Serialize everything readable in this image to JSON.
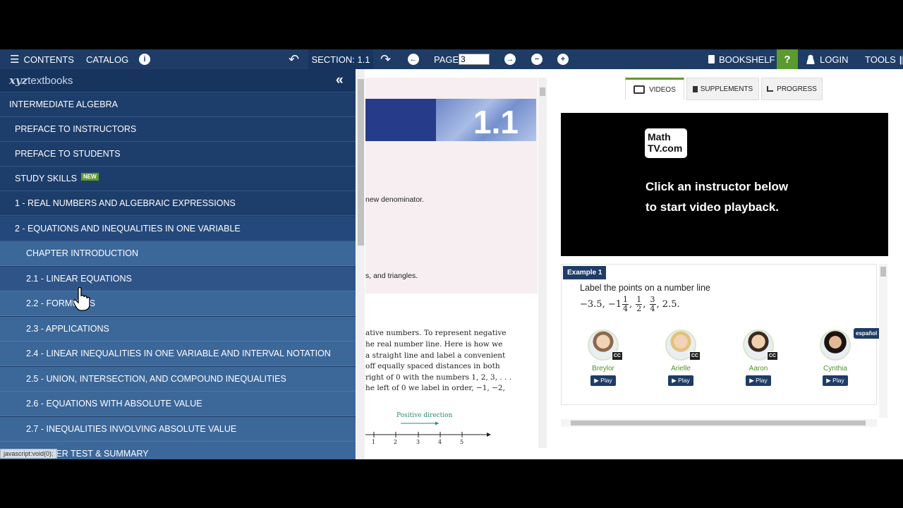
{
  "toolbar": {
    "contents": "CONTENTS",
    "catalog": "CATALOG",
    "section": "SECTION: 1.1",
    "page_label": "PAGE",
    "page_value": "3",
    "bookshelf": "BOOKSHELF",
    "help": "?",
    "login": "LOGIN",
    "tools": "TOOLS",
    "info_glyph": "i",
    "undo_glyph": "↶",
    "redo_glyph": "↷",
    "prev_glyph": "←",
    "next_glyph": "→",
    "zoom_out_glyph": "−",
    "zoom_in_glyph": "+"
  },
  "sidebar": {
    "logo_xyz": "xyz",
    "logo_rest": "textbooks",
    "collapse": "«",
    "items": [
      {
        "label": "INTERMEDIATE ALGEBRA"
      },
      {
        "label": "PREFACE TO INSTRUCTORS"
      },
      {
        "label": "PREFACE TO STUDENTS"
      },
      {
        "label": "STUDY SKILLS",
        "badge": "NEW"
      },
      {
        "label": "1 - REAL NUMBERS AND ALGEBRAIC EXPRESSIONS"
      },
      {
        "label": "2 - EQUATIONS AND INEQUALITIES IN ONE VARIABLE"
      },
      {
        "label": "CHAPTER INTRODUCTION"
      },
      {
        "label": "2.1 - LINEAR EQUATIONS"
      },
      {
        "label": "2.2 - FORMULAS"
      },
      {
        "label": "2.3 - APPLICATIONS"
      },
      {
        "label": "2.4 - LINEAR INEQUALITIES IN ONE VARIABLE AND INTERVAL NOTATION"
      },
      {
        "label": "2.5 - UNION, INTERSECTION, AND COMPOUND INEQUALITIES"
      },
      {
        "label": "2.6 - EQUATIONS WITH ABSOLUTE VALUE"
      },
      {
        "label": "2.7 - INEQUALITIES INVOLVING ABSOLUTE VALUE"
      },
      {
        "label": "CHAPTER TEST & SUMMARY"
      }
    ],
    "status": "javascript:void(0);"
  },
  "book": {
    "section_number": "1.1",
    "line1": "new denominator.",
    "line2": "s, and triangles.",
    "body": [
      "ative numbers. To represent negative",
      "he real number line. Here is how we",
      "a straight line and label a convenient",
      "off equally spaced distances in both",
      "right of 0 with the numbers 1, 2, 3, . . .",
      "he left of 0 we label in order, −1, −2,"
    ],
    "positive_direction": "Positive direction",
    "ticks": [
      "1",
      "2",
      "3",
      "4",
      "5"
    ]
  },
  "panel": {
    "tabs": [
      "VIDEOS",
      "SUPPLEMENTS",
      "PROGRESS"
    ],
    "video": {
      "logo_top": "Math",
      "logo_bottom": "TV.com",
      "message": "Click an instructor below\nto start video playback."
    },
    "example": {
      "label": "Example 1",
      "text": "Label the points on a number line",
      "math_prefix": "−3.5, −1",
      "math_suffix": ", 2.5.",
      "fractions": [
        [
          "1",
          "4"
        ],
        [
          "1",
          "2"
        ],
        [
          "3",
          "4"
        ]
      ],
      "instructors": [
        {
          "name": "Breylor",
          "cc": "CC",
          "play": "▶ Play"
        },
        {
          "name": "Arielle",
          "cc": "CC",
          "play": "▶ Play"
        },
        {
          "name": "Aaron",
          "cc": "CC",
          "play": "▶ Play"
        },
        {
          "name": "Cynthia",
          "cc": "",
          "play": "▶ Play"
        }
      ],
      "espanol": "español"
    }
  }
}
